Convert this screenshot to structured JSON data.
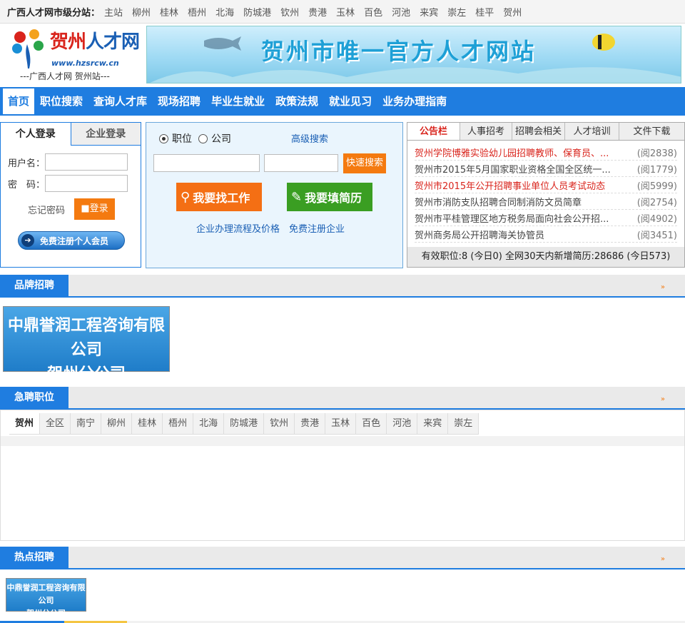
{
  "topbar": {
    "label": "广西人才网市级分站：",
    "cities": [
      "主站",
      "柳州",
      "桂林",
      "梧州",
      "北海",
      "防城港",
      "钦州",
      "贵港",
      "玉林",
      "百色",
      "河池",
      "来宾",
      "崇左",
      "桂平",
      "贺州"
    ]
  },
  "logo": {
    "name_part1": "贺州",
    "name_part2": "人才网",
    "url": "www.hzsrcw.cn",
    "subtitle": "---广西人才网 贺州站---"
  },
  "banner": {
    "text": "贺州市唯一官方人才网站"
  },
  "nav": {
    "items": [
      "首页",
      "职位搜索",
      "查询人才库",
      "现场招聘",
      "毕业生就业",
      "政策法规",
      "就业见习",
      "业务办理指南"
    ]
  },
  "login": {
    "tab_personal": "个人登录",
    "tab_company": "企业登录",
    "username_label": "用户名：",
    "password_label": "密　码：",
    "forgot": "忘记密码",
    "login_button": "登录",
    "register_button": "免费注册个人会员"
  },
  "search": {
    "radio_job": "职位",
    "radio_company": "公司",
    "advanced": "高级搜索",
    "quick_button": "快速搜索",
    "find_job": "我要找工作",
    "fill_resume": "我要填简历",
    "link_process": "企业办理流程及价格",
    "link_register": "免费注册企业"
  },
  "notice": {
    "tabs": [
      "公告栏",
      "人事招考",
      "招聘会相关",
      "人才培训",
      "文件下载"
    ],
    "items": [
      {
        "title": "贺州学院博雅实验幼儿园招聘教师、保育员、...",
        "reads": "(阅2838)",
        "red": true
      },
      {
        "title": "贺州市2015年5月国家职业资格全国全区统一...",
        "reads": "(阅1779)",
        "red": false
      },
      {
        "title": "贺州市2015年公开招聘事业单位人员考试动态",
        "reads": "(阅5999)",
        "red": true
      },
      {
        "title": "贺州市消防支队招聘合同制消防文员简章",
        "reads": "(阅2754)",
        "red": false
      },
      {
        "title": "贺州市平桂管理区地方税务局面向社会公开招...",
        "reads": "(阅4902)",
        "red": false
      },
      {
        "title": "贺州商务局公开招聘海关协管员",
        "reads": "(阅3451)",
        "red": false
      }
    ],
    "footer": "有效职位:8 (今日0) 全网30天内新增简历:28686 (今日573)"
  },
  "sections": {
    "brand": "品牌招聘",
    "urgent": "急聘职位",
    "hot": "热点招聘",
    "more_glyph": "»"
  },
  "brand_company": {
    "line1": "中鼎誉润工程咨询有限公司",
    "line2": "贺州分公司"
  },
  "urgent_tabs": [
    "贺州",
    "全区",
    "南宁",
    "柳州",
    "桂林",
    "梧州",
    "北海",
    "防城港",
    "钦州",
    "贵港",
    "玉林",
    "百色",
    "河池",
    "来宾",
    "崇左"
  ]
}
